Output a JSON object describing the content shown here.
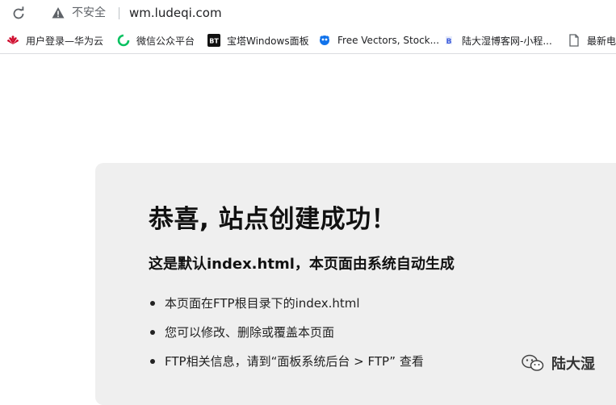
{
  "browser": {
    "security_label": "不安全",
    "url": "wm.ludeqi.com"
  },
  "bookmarks": [
    {
      "label": "用户登录—华为云",
      "icon": "huawei-icon",
      "color": "#cf0a2c"
    },
    {
      "label": "微信公众平台",
      "icon": "wechat-mp-icon",
      "color": "#07c160"
    },
    {
      "label": "宝塔Windows面板",
      "icon": "bt-icon",
      "color": "#111111"
    },
    {
      "label": "Free Vectors, Stock...",
      "icon": "freepik-icon",
      "color": "#1273eb"
    },
    {
      "label": "陆大湿博客网-小程...",
      "icon": "blog-icon",
      "color": "#3b5bdb"
    },
    {
      "label": "最新电影",
      "icon": "document-icon",
      "color": "#5f6368"
    }
  ],
  "content": {
    "title": "恭喜, 站点创建成功！",
    "subtitle": "这是默认index.html，本页面由系统自动生成",
    "items": [
      "本页面在FTP根目录下的index.html",
      "您可以修改、删除或覆盖本页面",
      "FTP相关信息，请到“面板系统后台 > FTP” 查看"
    ]
  },
  "watermark": {
    "text": "陆大湿",
    "icon": "wechat-icon"
  }
}
